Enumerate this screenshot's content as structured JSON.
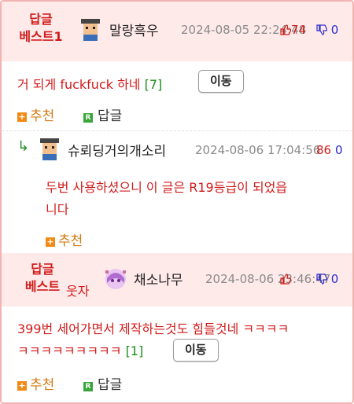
{
  "comments": [
    {
      "badge_line1": "답글",
      "badge_line2": "베스트1",
      "nickname": "말랑흑우",
      "date": "2024-08-05 22:24:48",
      "up": "74",
      "down": "0",
      "text": "거 되게 fuckfuck 하네",
      "reply_count": "[7]",
      "move_label": "이동",
      "recommend_label": "추천",
      "reply_label": "답글"
    },
    {
      "reply_arrow": "↳",
      "nickname": "슈뢰딩거의개소리",
      "date": "2024-08-06 17:04:56",
      "up": "86",
      "down": "0",
      "text_line1": "두번 사용하셨으니 이 글은 R19등급이 되었읍",
      "text_line2": "니다",
      "recommend_label": "추천"
    },
    {
      "badge_line1": "답글",
      "badge_line2": "베스트",
      "badge_suffix": "웃자",
      "nickname": "채소나무",
      "date": "2024-08-06 23:46:47",
      "up": "",
      "down": "0",
      "text_line1": "399번 세어가면서 제작하는것도 힘들것네 ㅋㅋㅋㅋ",
      "text_line2": "ㅋㅋㅋㅋㅋㅋㅋㅋㅋ",
      "reply_count": "[1]",
      "move_label": "이동",
      "recommend_label": "추천",
      "reply_label": "답글"
    }
  ],
  "icons": {
    "thumb_up": "thumb-up-icon",
    "thumb_down": "thumb-down-icon",
    "plus": "+",
    "reply_r": "R"
  },
  "colors": {
    "accent_red": "#d11b1b",
    "header_bg": "#ffeaea",
    "count_green": "#1a8f1a",
    "down_blue": "#2a2acb",
    "recommend_orange": "#f08a15"
  }
}
